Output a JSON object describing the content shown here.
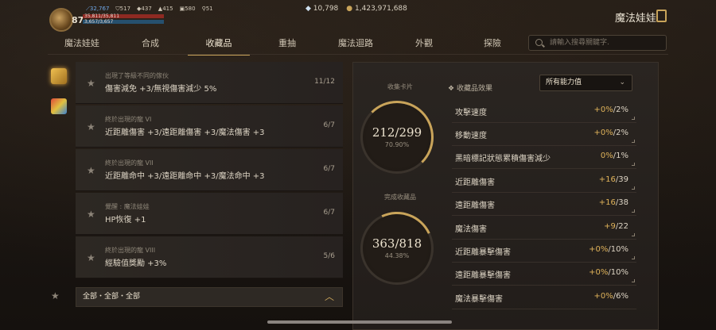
{
  "player": {
    "level": "87",
    "stat_power": "32,767",
    "stat_2": "517",
    "stat_3": "437",
    "stat_4": "415",
    "stat_5": "580",
    "stat_6": "51",
    "hp_text": "35,811/35,811",
    "mp_text": "3,657/3,657"
  },
  "currency": {
    "diamonds": "10,798",
    "gold": "1,423,971,688"
  },
  "character": {
    "name": "魔法娃娃"
  },
  "nav": {
    "tabs": [
      "魔法娃娃",
      "合成",
      "收藏品",
      "重抽",
      "魔法迴路",
      "外觀",
      "探險"
    ],
    "active_index": 2
  },
  "search": {
    "placeholder": "請輸入搜尋關鍵字."
  },
  "collection_list": [
    {
      "category": "出現了等級不同的傢伙",
      "desc": "傷害減免 +3/無視傷害減少 5%",
      "count": "11/12"
    },
    {
      "category": "終於出現的龍 VI",
      "desc": "近距離傷害 +3/遠距離傷害 +3/魔法傷害 +3",
      "count": "6/7"
    },
    {
      "category": "終於出現的龍 VII",
      "desc": "近距離命中 +3/遠距離命中 +3/魔法命中 +3",
      "count": "6/7"
    },
    {
      "category": "覺醒 : 魔法娃娃",
      "desc": "HP恢復 +1",
      "count": "6/7"
    },
    {
      "category": "終於出現的龍 VIII",
      "desc": "經驗值獎勵 +3%",
      "count": "5/6"
    }
  ],
  "filter": {
    "label": "全部・全部・全部"
  },
  "cards": {
    "label": "收集卡片",
    "value": "212/299",
    "pct": "70.90%",
    "fraction": 0.709
  },
  "completed": {
    "label": "完成收藏品",
    "value": "363/818",
    "pct": "44.38%",
    "fraction": 0.4438
  },
  "effects_panel": {
    "title": "收藏品效果",
    "dropdown": "所有能力值",
    "rows": [
      {
        "name": "攻擊速度",
        "bonus": "+0%",
        "max": "/2%"
      },
      {
        "name": "移動速度",
        "bonus": "+0%",
        "max": "/2%"
      },
      {
        "name": "黑暗標記狀態累積傷害減少",
        "bonus": "0%",
        "max": "/1%"
      },
      {
        "name": "近距離傷害",
        "bonus": "+16",
        "max": "/39"
      },
      {
        "name": "遠距離傷害",
        "bonus": "+16",
        "max": "/38"
      },
      {
        "name": "魔法傷害",
        "bonus": "+9",
        "max": "/22"
      },
      {
        "name": "近距離暴擊傷害",
        "bonus": "+0%",
        "max": "/10%"
      },
      {
        "name": "遠距離暴擊傷害",
        "bonus": "+0%",
        "max": "/10%"
      },
      {
        "name": "魔法暴擊傷害",
        "bonus": "+0%",
        "max": "/6%"
      }
    ]
  }
}
